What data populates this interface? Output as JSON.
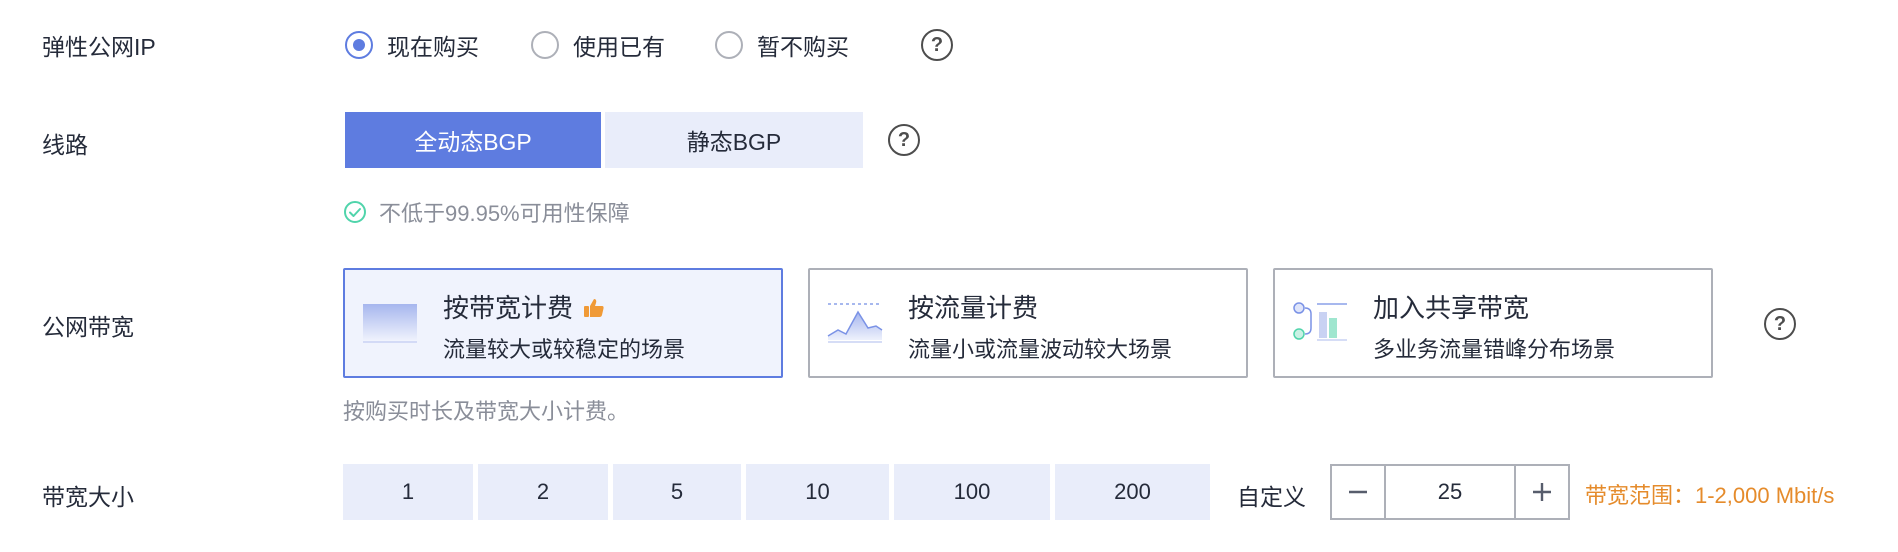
{
  "eip": {
    "label": "弹性公网IP",
    "options": [
      {
        "label": "现在购买",
        "checked": true
      },
      {
        "label": "使用已有",
        "checked": false
      },
      {
        "label": "暂不购买",
        "checked": false
      }
    ]
  },
  "line": {
    "label": "线路",
    "options": [
      {
        "label": "全动态BGP",
        "active": true
      },
      {
        "label": "静态BGP",
        "active": false
      }
    ],
    "note": "不低于99.95%可用性保障"
  },
  "bandwidth_billing": {
    "label": "公网带宽",
    "cards": [
      {
        "title": "按带宽计费",
        "desc": "流量较大或较稳定的场景",
        "selected": true,
        "icon": "bandwidth-billing-icon",
        "badge": "thumbs-up-icon"
      },
      {
        "title": "按流量计费",
        "desc": "流量小或流量波动较大场景",
        "selected": false,
        "icon": "traffic-billing-icon"
      },
      {
        "title": "加入共享带宽",
        "desc": "多业务流量错峰分布场景",
        "selected": false,
        "icon": "shared-bandwidth-icon"
      }
    ],
    "note": "按购买时长及带宽大小计费。"
  },
  "bandwidth_size": {
    "label": "带宽大小",
    "presets": [
      "1",
      "2",
      "5",
      "10",
      "100",
      "200"
    ],
    "custom_label": "自定义",
    "value": "25",
    "range_text": "带宽范围：1-2,000 Mbit/s"
  },
  "colors": {
    "accent": "#5e7ce0",
    "segment_bg": "#e9edfa",
    "warning": "#e58b2b",
    "success": "#50d4ab"
  }
}
